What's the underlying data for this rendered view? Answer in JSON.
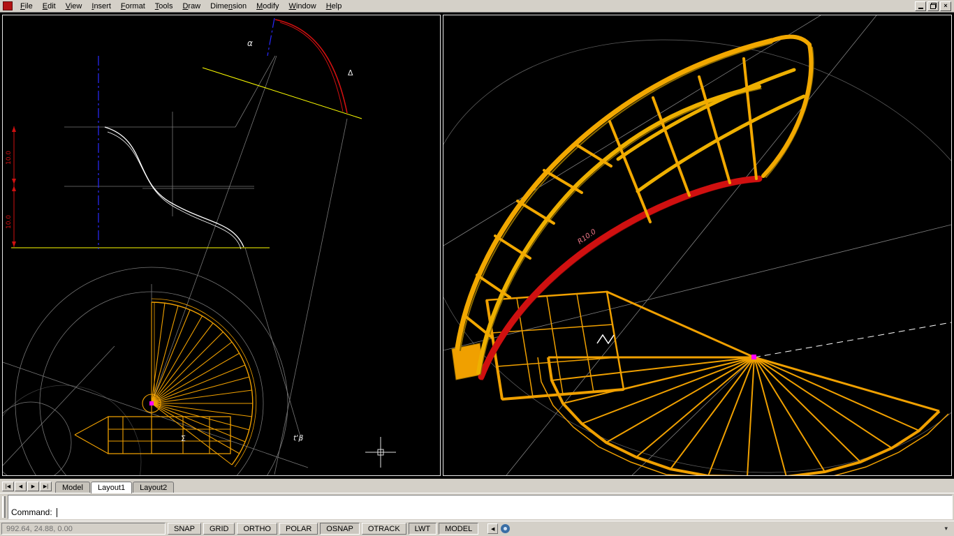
{
  "window": {
    "close_glyph": "×"
  },
  "menu": {
    "items": [
      {
        "label": "File",
        "u": 0
      },
      {
        "label": "Edit",
        "u": 0
      },
      {
        "label": "View",
        "u": 0
      },
      {
        "label": "Insert",
        "u": 0
      },
      {
        "label": "Format",
        "u": 0
      },
      {
        "label": "Tools",
        "u": 0
      },
      {
        "label": "Draw",
        "u": 0
      },
      {
        "label": "Dimension",
        "u": 4
      },
      {
        "label": "Modify",
        "u": 0
      },
      {
        "label": "Window",
        "u": 0
      },
      {
        "label": "Help",
        "u": 0
      }
    ]
  },
  "viewports": {
    "left": {
      "labels": {
        "alpha": "α",
        "delta": "Δ",
        "sigma": "Σ",
        "tbeta": "t'β",
        "dim_upper": "10.0",
        "dim_lower": "10.0"
      }
    },
    "right": {
      "labels": {
        "radius": "R10.0"
      }
    }
  },
  "colors": {
    "stair_orange": "#f0a000",
    "accent_red": "#d01010",
    "construction_yellow": "#ffff00",
    "centerline_blue": "#2a2aff",
    "marker_magenta": "#ff00ff"
  },
  "tabs": {
    "nav": [
      "|◀",
      "◀",
      "▶",
      "▶|"
    ],
    "items": [
      {
        "label": "Model",
        "active": false
      },
      {
        "label": "Layout1",
        "active": true
      },
      {
        "label": "Layout2",
        "active": false
      }
    ]
  },
  "command": {
    "prompt": "Command:"
  },
  "status": {
    "coords": "992.64, 24.88, 0.00",
    "toggles": [
      {
        "label": "SNAP",
        "pressed": false
      },
      {
        "label": "GRID",
        "pressed": false
      },
      {
        "label": "ORTHO",
        "pressed": false
      },
      {
        "label": "POLAR",
        "pressed": false
      },
      {
        "label": "OSNAP",
        "pressed": true
      },
      {
        "label": "OTRACK",
        "pressed": false
      },
      {
        "label": "LWT",
        "pressed": true
      },
      {
        "label": "MODEL",
        "pressed": true
      }
    ],
    "tray_collapse": "◀",
    "menu_arrow": "▾"
  }
}
